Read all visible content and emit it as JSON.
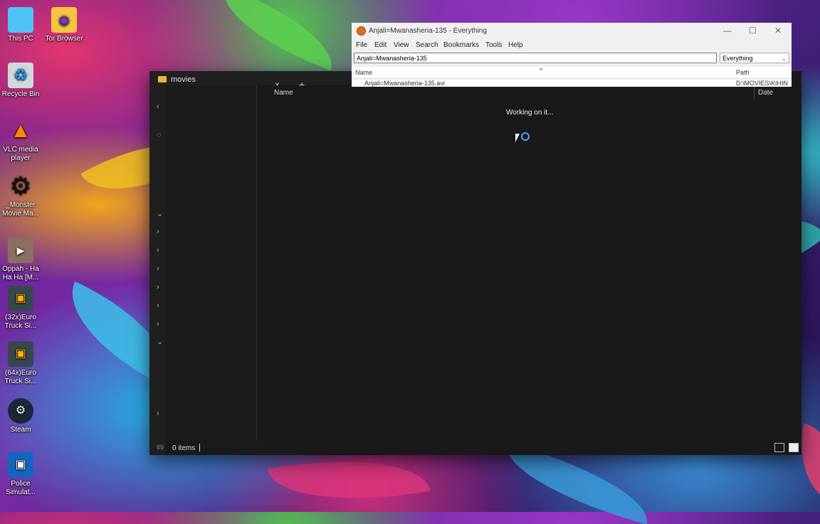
{
  "desktop": {
    "icons": [
      {
        "label": "This PC",
        "icon": "monitor-icon"
      },
      {
        "label": "Tor Browser",
        "icon": "folder-icon"
      },
      {
        "label": "Recycle Bin",
        "icon": "recycle-bin-icon"
      },
      {
        "label": "VLC media player",
        "icon": "vlc-cone-icon"
      },
      {
        "label": "_Monster Movie Ma...",
        "icon": "gear-icon"
      },
      {
        "label": "Oppah - Ha Ha Ha [M...",
        "icon": "video-file-icon"
      },
      {
        "label": "(32x)Euro Truck Si...",
        "icon": "game-shortcut-icon"
      },
      {
        "label": "(64x)Euro Truck Si...",
        "icon": "game-shortcut-icon"
      },
      {
        "label": "Steam",
        "icon": "steam-icon"
      },
      {
        "label": "Police Simulat...",
        "icon": "game-shortcut-icon"
      }
    ]
  },
  "explorer": {
    "tab_label": "movies",
    "tab_close": "×",
    "tab_add": "+",
    "columns": {
      "name": "Name",
      "date": "Date"
    },
    "loading_text": "Working on it...",
    "status": {
      "items": "0 items"
    },
    "side_number": "69"
  },
  "everything": {
    "title": "Anjali=Mwanasheria-135 - Everything",
    "menu": [
      "File",
      "Edit",
      "View",
      "Search",
      "Bookmarks",
      "Tools",
      "Help"
    ],
    "search_value": "Anjali=Mwanasheria-135",
    "filter": "Everything",
    "columns": {
      "name": "Name",
      "path": "Path"
    },
    "result_row": {
      "name": "Anjali=Mwanasheria-135.avi",
      "path": "D:\\MOVIES\\KIHIN"
    },
    "controls": {
      "minimize": "—",
      "maximize": "☐",
      "close": "✕"
    }
  },
  "colors": {
    "accent": "#4aa3ff",
    "explorer_bg": "#191919",
    "everything_bg": "#f0f0f0"
  }
}
